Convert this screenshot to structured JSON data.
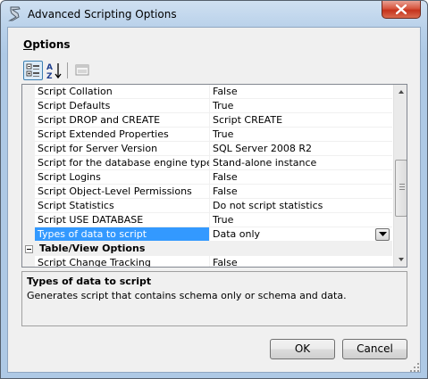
{
  "window": {
    "title": "Advanced Scripting Options"
  },
  "options": {
    "label_underlined": "O",
    "label_rest": "ptions"
  },
  "toolbar": {
    "categorized_icon": "categorized-icon",
    "alphabetical_icon": "sort-az-icon",
    "property_pages_icon": "property-pages-icon"
  },
  "grid": {
    "rows": [
      {
        "name": "Script Collation",
        "value": "False"
      },
      {
        "name": "Script Defaults",
        "value": "True"
      },
      {
        "name": "Script DROP and CREATE",
        "value": "Script CREATE"
      },
      {
        "name": "Script Extended Properties",
        "value": "True"
      },
      {
        "name": "Script for Server Version",
        "value": "SQL Server 2008 R2"
      },
      {
        "name": "Script for the database engine type",
        "value": "Stand-alone instance"
      },
      {
        "name": "Script Logins",
        "value": "False"
      },
      {
        "name": "Script Object-Level Permissions",
        "value": "False"
      },
      {
        "name": "Script Statistics",
        "value": "Do not script statistics"
      },
      {
        "name": "Script USE DATABASE",
        "value": "True"
      },
      {
        "name": "Types of data to script",
        "value": "Data only",
        "selected": true
      }
    ],
    "category": {
      "name": "Table/View Options"
    },
    "after_category": [
      {
        "name": "Script Change Tracking",
        "value": "False"
      }
    ]
  },
  "description": {
    "title": "Types of data to script",
    "text": "Generates script that contains schema only or schema and data."
  },
  "buttons": {
    "ok": "OK",
    "cancel": "Cancel"
  },
  "colors": {
    "selection": "#3399ff",
    "frame": "#b9d1ea",
    "close": "#c5331c"
  }
}
